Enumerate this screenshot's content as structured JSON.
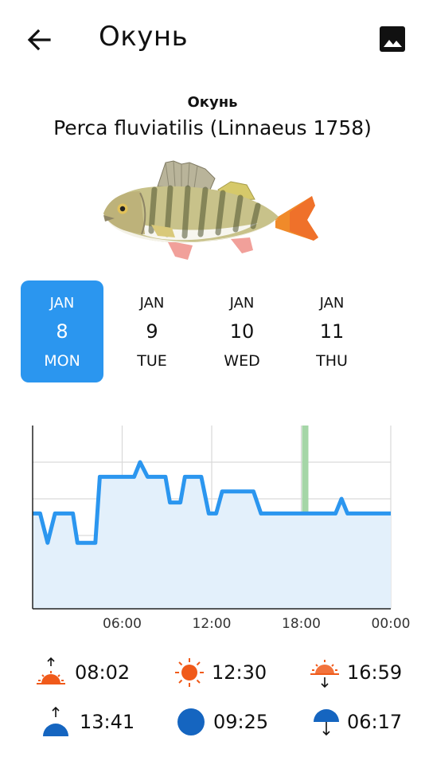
{
  "header": {
    "title": "Окунь",
    "back_icon": "arrow-left-icon",
    "image_icon": "image-icon"
  },
  "fish": {
    "common_name": "Окунь",
    "latin_name": "Perca fluviatilis (Linnaeus 1758)"
  },
  "days": [
    {
      "month": "JAN",
      "day": "8",
      "weekday": "MON",
      "selected": true
    },
    {
      "month": "JAN",
      "day": "9",
      "weekday": "TUE",
      "selected": false
    },
    {
      "month": "JAN",
      "day": "10",
      "weekday": "WED",
      "selected": false
    },
    {
      "month": "JAN",
      "day": "11",
      "weekday": "THU",
      "selected": false
    }
  ],
  "colors": {
    "accent": "#2b96ef",
    "line": "#2b96ef",
    "fill": "#e3f0fb",
    "marker": "#a5d6a7",
    "sun": "#f05a1a",
    "moon": "#1565c0"
  },
  "chart_data": {
    "type": "line",
    "x_tick_labels": [
      "06:00",
      "12:00",
      "18:00",
      "00:00"
    ],
    "x_range": [
      0,
      24
    ],
    "y_range": [
      0,
      5
    ],
    "current_time_marker": 18.0,
    "grid": true,
    "points": [
      [
        0.0,
        2.6
      ],
      [
        0.5,
        2.6
      ],
      [
        1.0,
        1.8
      ],
      [
        1.5,
        2.6
      ],
      [
        2.7,
        2.6
      ],
      [
        3.0,
        1.8
      ],
      [
        4.2,
        1.8
      ],
      [
        4.5,
        3.6
      ],
      [
        6.8,
        3.6
      ],
      [
        7.2,
        4.0
      ],
      [
        7.7,
        3.6
      ],
      [
        8.9,
        3.6
      ],
      [
        9.2,
        2.9
      ],
      [
        9.9,
        2.9
      ],
      [
        10.2,
        3.6
      ],
      [
        11.3,
        3.6
      ],
      [
        11.8,
        2.6
      ],
      [
        12.3,
        2.6
      ],
      [
        12.7,
        3.2
      ],
      [
        14.8,
        3.2
      ],
      [
        15.3,
        2.6
      ],
      [
        20.3,
        2.6
      ],
      [
        20.7,
        3.0
      ],
      [
        21.1,
        2.6
      ],
      [
        24.0,
        2.6
      ]
    ]
  },
  "sun": {
    "sunrise": {
      "icon": "sunrise-icon",
      "time": "08:02"
    },
    "noon": {
      "icon": "sun-icon",
      "time": "12:30"
    },
    "sunset": {
      "icon": "sunset-icon",
      "time": "16:59"
    }
  },
  "moon": {
    "moonrise": {
      "icon": "moonrise-icon",
      "time": "13:41"
    },
    "moon_phase": {
      "icon": "moon-icon",
      "time": "09:25"
    },
    "moonset": {
      "icon": "moonset-icon",
      "time": "06:17"
    }
  }
}
